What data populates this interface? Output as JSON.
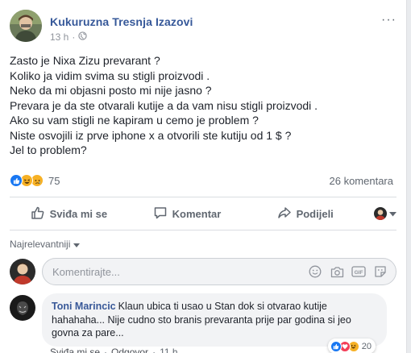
{
  "post": {
    "author": "Kukuruzna Tresnja Izazovi",
    "time": "13 h",
    "separator": "·",
    "more_label": "···",
    "lines": [
      "Zasto je Nixa Zizu prevarant ?",
      "Koliko ja vidim svima su stigli proizvodi .",
      "Neko da mi objasni posto mi nije jasno ?",
      "Prevara je da ste otvarali kutije a da vam nisu stigli proizvodi .",
      "Ako su vam stigli ne kapiram u cemo je problem ?",
      "Niste osvojili iz prve iphone x a otvorili ste kutiju od 1 $ ?",
      "Jel to problem?"
    ],
    "reaction_count": "75",
    "comment_count": "26 komentara"
  },
  "actions": {
    "like": "Sviđa mi se",
    "comment": "Komentar",
    "share": "Podijeli"
  },
  "comments_section": {
    "sort_label": "Najrelevantniji",
    "composer_placeholder": "Komentirajte...",
    "gif_label": "GIF"
  },
  "comment": {
    "author": "Toni Marincic",
    "text_line1": "Klaun ubica ti usao u Stan dok si otvarao kutije",
    "text_line2": "hahahaha... Nije cudno sto branis prevaranta prije par godina si jeo",
    "text_line3": "govna za pare...",
    "reaction_count": "20",
    "like_link": "Sviđa mi se",
    "reply_link": "Odgovor",
    "time": "11 h",
    "separator": "·"
  },
  "colors": {
    "link": "#365899",
    "like_blue": "#1877f2",
    "love_red": "#f33e58",
    "haha_yellow": "#f7b125"
  }
}
